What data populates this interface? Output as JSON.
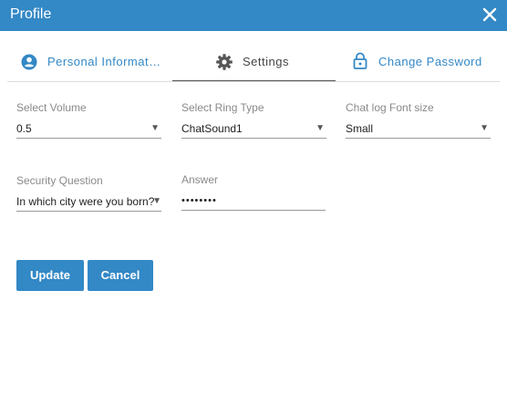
{
  "window": {
    "title": "Profile"
  },
  "tabs": [
    {
      "label": "Personal Informat…",
      "icon": "account-circle-icon",
      "active": false
    },
    {
      "label": "Settings",
      "icon": "gear-icon",
      "active": true
    },
    {
      "label": "Change Password",
      "icon": "lock-icon",
      "active": false
    }
  ],
  "form": {
    "volume": {
      "label": "Select Volume",
      "value": "0.5"
    },
    "ring_type": {
      "label": "Select Ring Type",
      "value": "ChatSound1"
    },
    "font_size": {
      "label": "Chat log Font size",
      "value": "Small"
    },
    "security_question": {
      "label": "Security Question",
      "value": "In which city were you born?"
    },
    "answer": {
      "label": "Answer",
      "value": "••••••••"
    }
  },
  "buttons": {
    "update": "Update",
    "cancel": "Cancel"
  },
  "colors": {
    "accent": "#3388c6",
    "titlebar": "#3388c6"
  }
}
